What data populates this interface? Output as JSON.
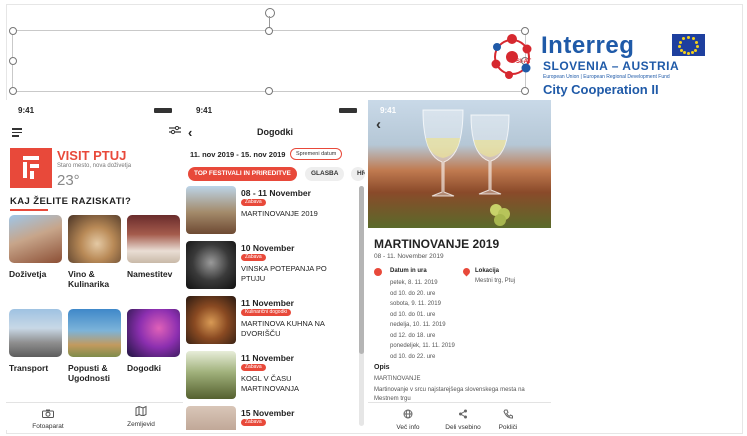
{
  "header": {
    "interreg": "Interreg",
    "region": "SLOVENIA – AUSTRIA",
    "fund": "European Union | European Regional Development Fund",
    "city": "City Cooperation II",
    "logo_mark": "SI-AT"
  },
  "status_time": "9:41",
  "home": {
    "brand": "VISIT PTUJ",
    "tagline": "Staro mesto, nova doživetja",
    "temperature": "23°",
    "section_title": "KAJ ŽELITE RAZISKATI?",
    "tiles": [
      {
        "label": "Doživetja"
      },
      {
        "label": "Vino & Kulinarika"
      },
      {
        "label": "Namestitev"
      },
      {
        "label": "Transport"
      },
      {
        "label": "Popusti & Ugodnosti"
      },
      {
        "label": "Dogodki"
      }
    ],
    "tabs": [
      {
        "label": "Fotoaparat"
      },
      {
        "label": "Zemljevid"
      }
    ]
  },
  "events": {
    "title": "Dogodki",
    "date_range": "11. nov 2019 - 15. nov 2019",
    "change_button": "Spremeni datum",
    "filters": [
      "TOP FESTIVALI IN PRIREDITVE",
      "GLASBA",
      "HR"
    ],
    "items": [
      {
        "date": "08 - 11 November",
        "badge": "Zabava",
        "title": "MARTINOVANJE 2019"
      },
      {
        "date": "10 November",
        "badge": "Zabava",
        "title": "VINSKA POTEPANJA PO PTUJU"
      },
      {
        "date": "11 November",
        "badge": "Kulinarični dogodki",
        "title": "MARTINOVA KUHNA NA DVORIŠČU"
      },
      {
        "date": "11 November",
        "badge": "Zabava",
        "title": "KOGL V ČASU MARTINOVANJA"
      },
      {
        "date": "15 November",
        "badge": "Zabava",
        "title": ""
      }
    ]
  },
  "detail": {
    "title": "MARTINOVANJE 2019",
    "dates": "08 - 11. November 2019",
    "date_heading": "Datum in ura",
    "schedule": [
      "petek, 8. 11. 2019",
      "od 10. do 20. ure",
      "sobota, 9. 11. 2019",
      "od 10. do 01. ure",
      "nedelja, 10. 11. 2019",
      "od 12. do 18. ure",
      "ponedeljek, 11. 11. 2019",
      "od 10. do 22. ure"
    ],
    "location_heading": "Lokacija",
    "location": "Mestni trg, Ptuj",
    "desc_heading": "Opis",
    "desc_title": "MARTINOVANJE",
    "desc_text": "Martinovanje v srcu najstarejšega slovenskega mesta na Mestnem trgu",
    "actions": [
      {
        "label": "Več info"
      },
      {
        "label": "Deli vsebino"
      },
      {
        "label": "Pokliči"
      }
    ]
  },
  "colors": {
    "accent": "#e8493a",
    "brand_blue": "#1f5aa8"
  }
}
